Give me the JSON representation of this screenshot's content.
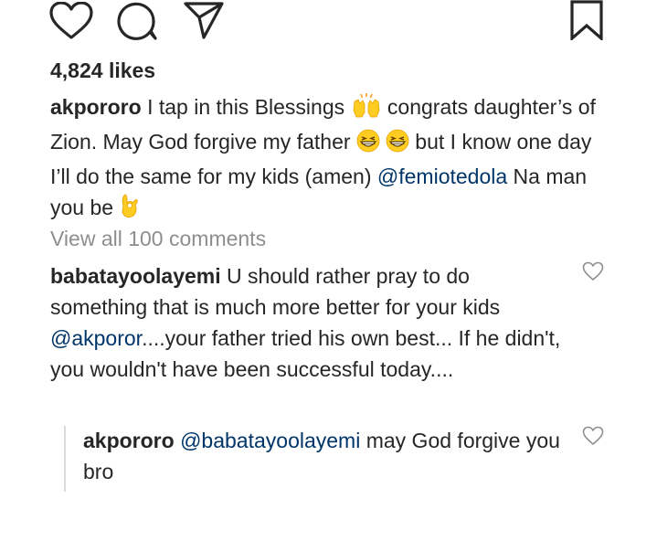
{
  "post": {
    "likes_text": "4,824 likes",
    "caption": {
      "username": "akpororo",
      "text_1": " I tap in this Blessings ",
      "text_2": " congrats daughter’s of Zion. May God forgive my father ",
      "text_3": " but I know one day I’ll do the same for my kids (amen) ",
      "mention": "@femiotedola",
      "text_4": " Na man you be "
    },
    "view_all_comments": "View all 100 comments"
  },
  "comment": {
    "username": "babatayoolayemi",
    "text_1": " U should rather pray to do something that is much more better for your kids ",
    "mention": "@akporor",
    "text_2": "....your father tried his own best... If he didn't, you wouldn't have been successful today...."
  },
  "reply": {
    "username": "akpororo",
    "mention": "@babatayoolayemi",
    "text": " may God forgive you bro"
  },
  "icons": {
    "like": "heart-icon",
    "comment": "comment-bubble-icon",
    "share": "paper-plane-icon",
    "save": "bookmark-icon",
    "emoji_1": "raising-hands-emoji",
    "emoji_2": "grinning-squinting-face-emoji",
    "emoji_3": "ok-hand-emoji"
  },
  "colors": {
    "text": "#262626",
    "mention": "#003569",
    "muted": "#8e8e8e",
    "emoji_yellow": "#ffcc22"
  }
}
